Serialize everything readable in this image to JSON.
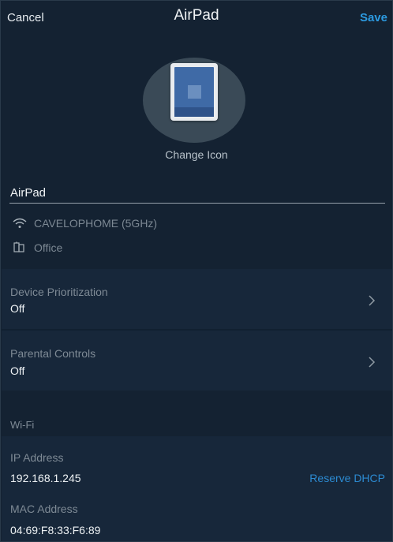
{
  "header": {
    "cancel_label": "Cancel",
    "title": "AirPad",
    "save_label": "Save"
  },
  "device": {
    "icon": "tablet-icon",
    "change_icon_label": "Change Icon",
    "name_value": "AirPad",
    "network": "CAVELOPHOME (5GHz)",
    "network_icon": "wifi-icon",
    "location": "Office",
    "location_icon": "room-icon"
  },
  "settings": {
    "prioritization": {
      "label": "Device Prioritization",
      "value": "Off"
    },
    "parental": {
      "label": "Parental Controls",
      "value": "Off"
    }
  },
  "wifi": {
    "section_title": "Wi-Fi",
    "ip_label": "IP Address",
    "ip_value": "192.168.1.245",
    "reserve_label": "Reserve DHCP",
    "mac_label": "MAC Address",
    "mac_value": "04:69:F8:33:F6:89"
  },
  "colors": {
    "background": "#142232",
    "accent": "#2c9ae0",
    "muted_text": "#7e8a95"
  }
}
